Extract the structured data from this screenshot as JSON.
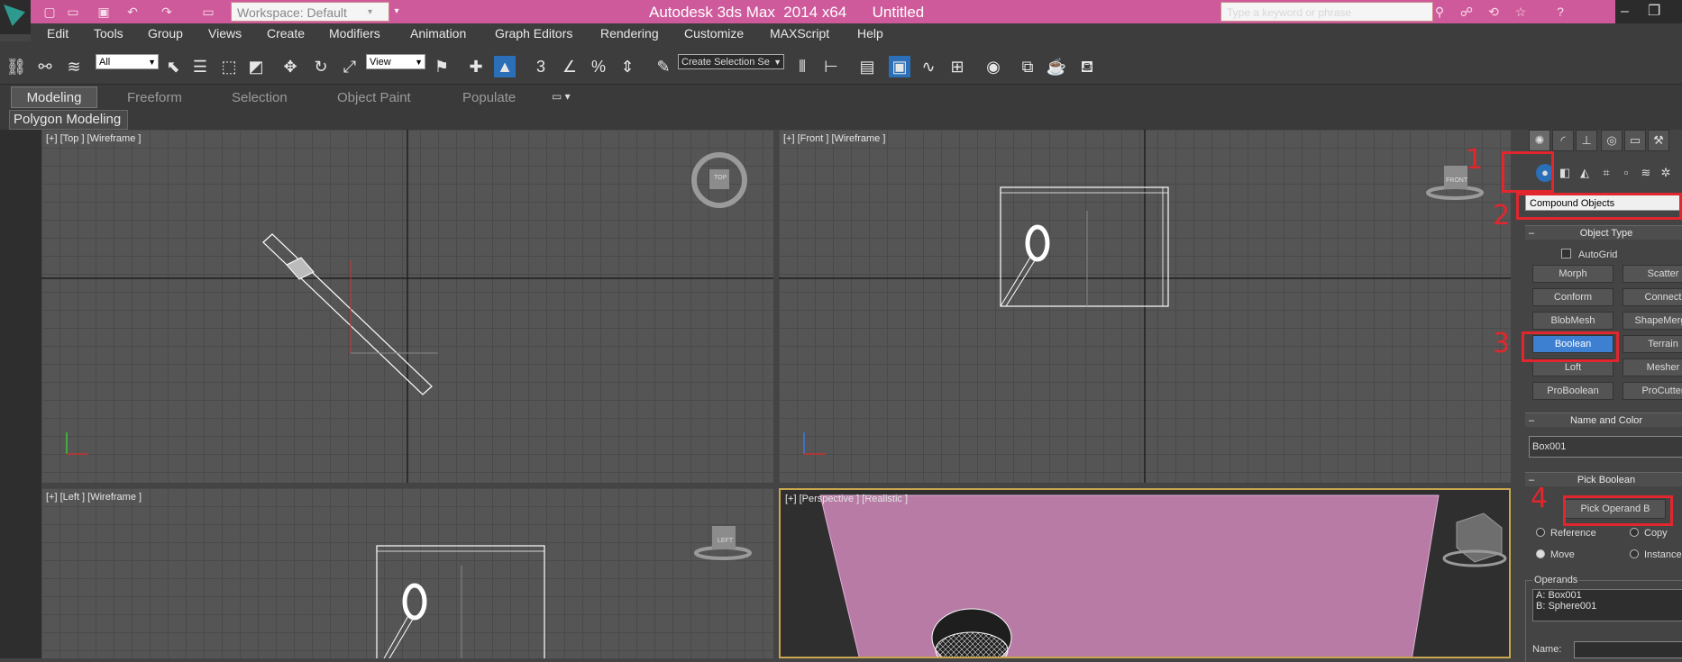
{
  "titlebar": {
    "workspace": "Workspace: Default",
    "title": "Autodesk 3ds Max  2014 x64      Untitled",
    "search_placeholder": "Type a keyword or phrase",
    "quick_access_icons": [
      "new-icon",
      "open-icon",
      "save-icon",
      "undo-icon",
      "redo-icon",
      "project-folder-icon"
    ]
  },
  "menu": [
    "Edit",
    "Tools",
    "Group",
    "Views",
    "Create",
    "Modifiers",
    "Animation",
    "Graph Editors",
    "Rendering",
    "Customize",
    "MAXScript",
    "Help"
  ],
  "toolbar": {
    "selection_filter": "All",
    "reference_coord": "View",
    "selection_set": "Create Selection Se"
  },
  "ribbon": {
    "tabs": [
      "Modeling",
      "Freeform",
      "Selection",
      "Object Paint",
      "Populate"
    ],
    "panel": "Polygon Modeling"
  },
  "viewports": {
    "top": "[+] [Top ] [Wireframe ]",
    "front": "[+] [Front ] [Wireframe ]",
    "left": "[+] [Left ] [Wireframe ]",
    "perspective": "[+] [Perspective ] [Realistic ]",
    "cube_top": "TOP",
    "cube_front": "FRONT",
    "cube_left": "LEFT"
  },
  "command_panel": {
    "category": "Compound Objects",
    "object_type_header": "Object Type",
    "autogrid": "AutoGrid",
    "buttons": [
      "Morph",
      "Scatter",
      "Conform",
      "Connect",
      "BlobMesh",
      "ShapeMerge",
      "Boolean",
      "Terrain",
      "Loft",
      "Mesher",
      "ProBoolean",
      "ProCutter"
    ],
    "name_color_header": "Name and Color",
    "object_name": "Box001",
    "pick_boolean_header": "Pick Boolean",
    "pick_operand": "Pick Operand B",
    "radio_reference": "Reference",
    "radio_copy": "Copy",
    "radio_move": "Move",
    "radio_instance": "Instance",
    "operands_label": "Operands",
    "operand_a": "A: Box001",
    "operand_b": "B: Sphere001",
    "name_label": "Name:"
  },
  "annotations": [
    "1",
    "2",
    "3",
    "4"
  ],
  "colors": {
    "titlebar": "#cf5a9b",
    "active_button": "#3d7fd1",
    "callout": "#e1262e",
    "persp_object": "#b77ba6"
  }
}
